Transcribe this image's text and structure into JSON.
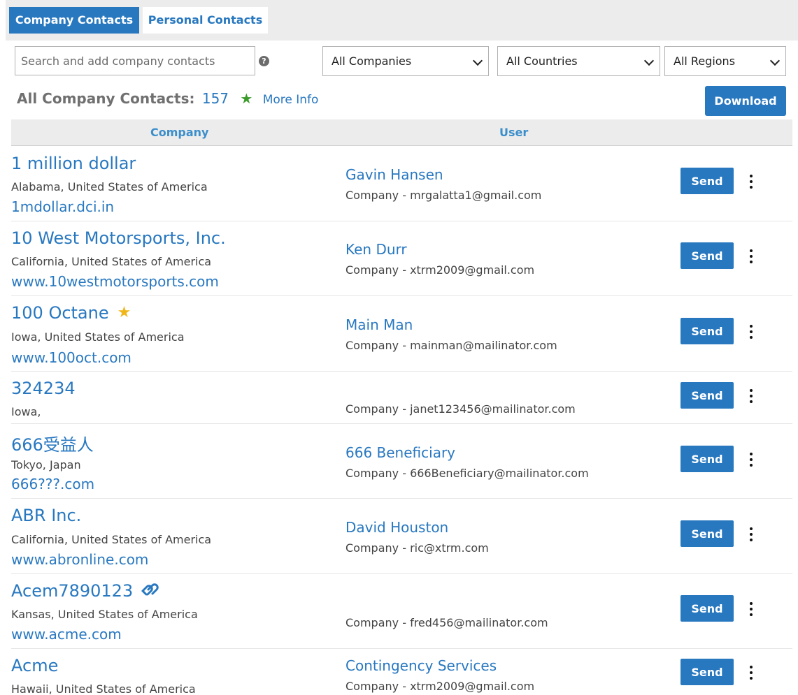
{
  "tabs": {
    "company": "Company Contacts",
    "personal": "Personal Contacts"
  },
  "filters": {
    "search_placeholder": "Search and add company contacts",
    "companies": "All Companies",
    "countries": "All Countries",
    "regions": "All Regions"
  },
  "summary": {
    "label": "All Company Contacts:",
    "count": "157",
    "more_info": "More Info",
    "download": "Download"
  },
  "table": {
    "headers": {
      "company": "Company",
      "user": "User"
    },
    "send_label": "Send",
    "rows": [
      {
        "company": "1 million dollar",
        "location": "Alabama, United States of America",
        "url": "1mdollar.dci.in",
        "user": "Gavin Hansen",
        "email": "Company - mrgalatta1@gmail.com"
      },
      {
        "company": "10 West Motorsports, Inc.",
        "location": "California, United States of America",
        "url": "www.10westmotorsports.com",
        "user": "Ken Durr",
        "email": "Company - xtrm2009@gmail.com"
      },
      {
        "company": "100 Octane",
        "location": "Iowa, United States of America",
        "url": "www.100oct.com",
        "user": "Main Man",
        "email": "Company - mainman@mailinator.com",
        "icon": "gold-star-icon"
      },
      {
        "company": "324234",
        "location": "Iowa,",
        "url": "",
        "user": "",
        "email": "Company - janet123456@mailinator.com"
      },
      {
        "company": "666受益人",
        "location": "Tokyo, Japan",
        "url": "666???.com",
        "user": "666 Beneficiary",
        "email": "Company - 666Beneficiary@mailinator.com"
      },
      {
        "company": "ABR Inc.",
        "location": "California, United States of America",
        "url": "www.abronline.com",
        "user": "David Houston",
        "email": "Company - ric@xtrm.com"
      },
      {
        "company": "Acem7890123",
        "location": "Kansas, United States of America",
        "url": "www.acme.com",
        "user": "",
        "email": "Company - fred456@mailinator.com",
        "icon": "link-icon"
      },
      {
        "company": "Acme",
        "location": "Hawaii, United States of America",
        "url": "",
        "user": "Contingency Services",
        "email": "Company - xtrm2009@gmail.com"
      }
    ]
  },
  "colors": {
    "accent": "#2878c0",
    "header_bg": "#ececec",
    "green_star": "#3a9a2a",
    "gold_star": "#f0b619"
  }
}
